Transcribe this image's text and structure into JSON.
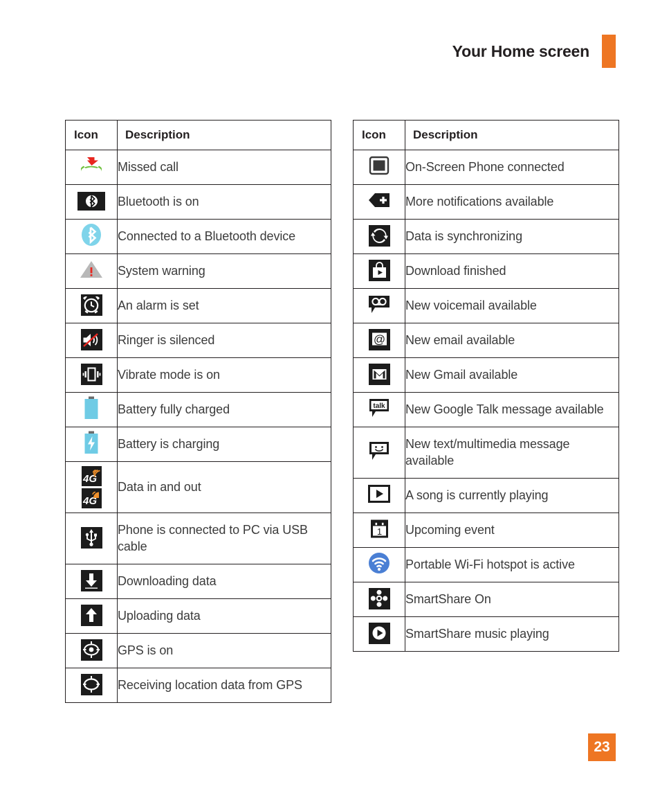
{
  "header": {
    "title": "Your Home screen"
  },
  "page_number": "23",
  "colors": {
    "accent_orange": "#ee7623",
    "text": "#3b3b3b",
    "rule": "#231f20",
    "tile_dark": "#1c1c1c",
    "light_blue": "#6fcbe5",
    "bluetooth_blue": "#7fd4ea",
    "wifi_blue": "#4a7fd4",
    "call_green": "#6ec03c",
    "call_red": "#e8261f",
    "warning_grey": "#b3b3b3",
    "warning_red": "#e8261f",
    "signal_orange": "#f0902b"
  },
  "tables": [
    {
      "id": "left",
      "headers": {
        "icon": "Icon",
        "description": "Description"
      },
      "rows": [
        {
          "icon": "missed-call-icon",
          "description": "Missed call"
        },
        {
          "icon": "bluetooth-on-icon",
          "description": "Bluetooth is on"
        },
        {
          "icon": "bluetooth-connected-icon",
          "description": "Connected to a Bluetooth device"
        },
        {
          "icon": "system-warning-icon",
          "description": "System warning"
        },
        {
          "icon": "alarm-set-icon",
          "description": "An alarm is set"
        },
        {
          "icon": "ringer-silenced-icon",
          "description": "Ringer is silenced"
        },
        {
          "icon": "vibrate-mode-icon",
          "description": "Vibrate mode is on"
        },
        {
          "icon": "battery-full-icon",
          "description": "Battery fully charged"
        },
        {
          "icon": "battery-charging-icon",
          "description": "Battery is charging"
        },
        {
          "icon": "data-in-out-icon",
          "description": "Data in and out"
        },
        {
          "icon": "usb-connected-icon",
          "description": "Phone is connected to PC via USB cable"
        },
        {
          "icon": "downloading-data-icon",
          "description": "Downloading data"
        },
        {
          "icon": "uploading-data-icon",
          "description": "Uploading data"
        },
        {
          "icon": "gps-on-icon",
          "description": "GPS is on"
        },
        {
          "icon": "gps-receiving-icon",
          "description": "Receiving location data from GPS"
        }
      ]
    },
    {
      "id": "right",
      "headers": {
        "icon": "Icon",
        "description": "Description"
      },
      "rows": [
        {
          "icon": "on-screen-phone-icon",
          "description": "On-Screen Phone connected"
        },
        {
          "icon": "more-notifications-icon",
          "description": "More notifications available"
        },
        {
          "icon": "data-sync-icon",
          "description": "Data is synchronizing"
        },
        {
          "icon": "download-finished-icon",
          "description": "Download finished"
        },
        {
          "icon": "voicemail-icon",
          "description": "New voicemail available"
        },
        {
          "icon": "email-icon",
          "description": "New email available"
        },
        {
          "icon": "gmail-icon",
          "description": "New Gmail available"
        },
        {
          "icon": "google-talk-icon",
          "description": "New Google Talk message available"
        },
        {
          "icon": "sms-mms-icon",
          "description": "New text/multimedia message available"
        },
        {
          "icon": "music-playing-icon",
          "description": "A song is currently playing"
        },
        {
          "icon": "calendar-event-icon",
          "description": "Upcoming event"
        },
        {
          "icon": "wifi-hotspot-icon",
          "description": "Portable Wi-Fi hotspot is active"
        },
        {
          "icon": "smartshare-on-icon",
          "description": "SmartShare On"
        },
        {
          "icon": "smartshare-music-icon",
          "description": "SmartShare music playing"
        }
      ]
    }
  ]
}
